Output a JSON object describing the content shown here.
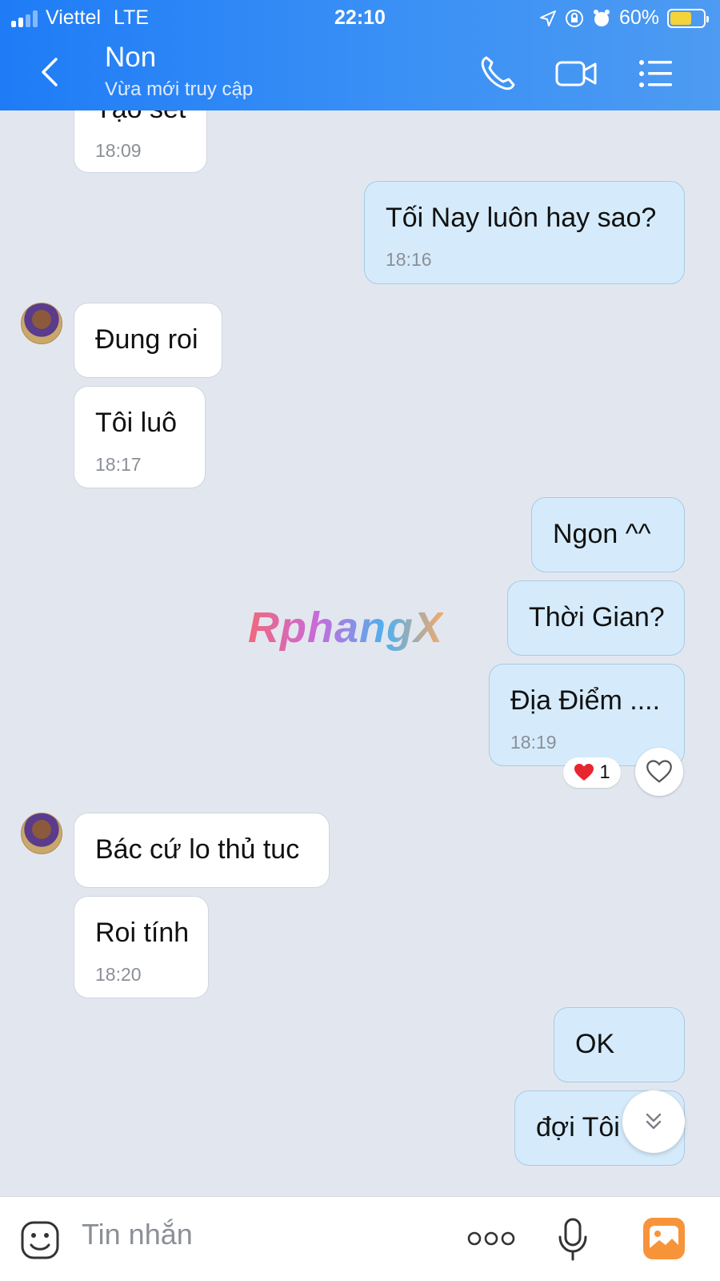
{
  "status_bar": {
    "carrier": "Viettel",
    "network": "LTE",
    "time": "22:10",
    "battery_percent": "60%"
  },
  "header": {
    "title": "Non",
    "subtitle": "Vừa mới truy cập"
  },
  "messages": [
    {
      "side": "in",
      "text": "Tạo set",
      "time": "18:09"
    },
    {
      "side": "out",
      "text": "Tối Nay luôn hay sao?",
      "time": "18:16"
    },
    {
      "side": "in",
      "text": "Đung roi",
      "time": ""
    },
    {
      "side": "in",
      "text": "Tôi luô",
      "time": "18:17"
    },
    {
      "side": "out",
      "text": "Ngon ^^",
      "time": ""
    },
    {
      "side": "out",
      "text": "Thời Gian?",
      "time": ""
    },
    {
      "side": "out",
      "text": "Địa Điểm ....",
      "time": "18:19"
    },
    {
      "side": "in",
      "text": "Bác cứ lo thủ tuc",
      "time": ""
    },
    {
      "side": "in",
      "text": "Roi tính",
      "time": "18:20"
    },
    {
      "side": "out",
      "text": "OK",
      "time": ""
    },
    {
      "side": "out",
      "text": "đợi Tôi",
      "time": ""
    }
  ],
  "reaction": {
    "count": "1",
    "emoji": "heart"
  },
  "watermark": "RphangX",
  "composer": {
    "placeholder": "Tin nhắn"
  },
  "colors": {
    "header_start": "#1f7cf6",
    "header_end": "#4d9bf2",
    "chat_background": "#e2e7ef",
    "incoming_bubble": "#ffffff",
    "outgoing_bubble": "#d5ebfb",
    "timestamp": "#8b8f96"
  }
}
